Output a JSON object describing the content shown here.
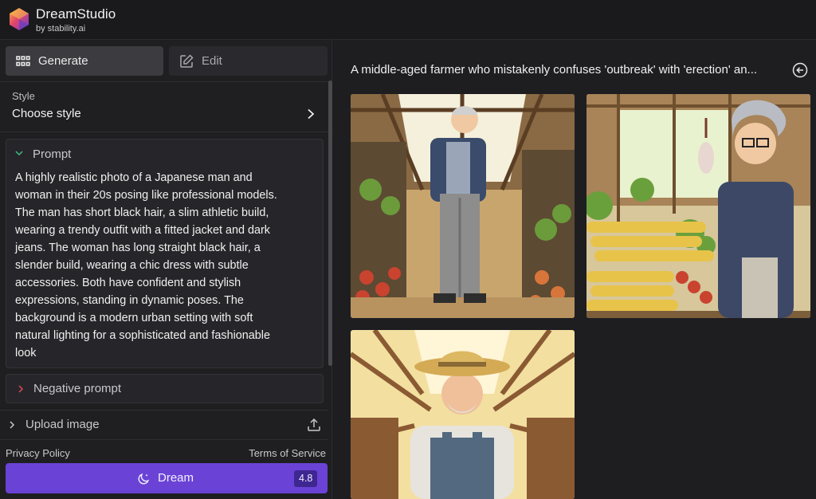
{
  "app": {
    "name": "DreamStudio",
    "subtitle": "by stability.ai"
  },
  "tabs": [
    {
      "label": "Generate",
      "icon": "grid-icon",
      "active": true
    },
    {
      "label": "Edit",
      "icon": "edit-icon",
      "active": false
    }
  ],
  "style": {
    "label": "Style",
    "value": "Choose style"
  },
  "prompt": {
    "title": "Prompt",
    "lines": [
      "A highly realistic photo of a Japanese man and",
      "woman in their 20s posing like professional models.",
      "The man has short black hair, a slim athletic build,",
      "wearing a trendy outfit with a fitted jacket and dark",
      "jeans. The woman has long straight black hair, a",
      "slender build, wearing a chic dress with subtle",
      "accessories. Both have confident and stylish",
      "expressions, standing in dynamic poses. The",
      "background is a modern urban setting with soft",
      "natural lighting for a sophisticated and fashionable",
      "look"
    ]
  },
  "negative_prompt": {
    "title": "Negative prompt"
  },
  "upload": {
    "title": "Upload image"
  },
  "footer": {
    "privacy": "Privacy Policy",
    "terms": "Terms of Service"
  },
  "dream": {
    "label": "Dream",
    "cost": "4.8"
  },
  "generation": {
    "title": "A middle-aged farmer who mistakenly confuses 'outbreak' with 'erection' an..."
  },
  "colors": {
    "accent": "#6a43d6",
    "background": "#1e1e21"
  }
}
